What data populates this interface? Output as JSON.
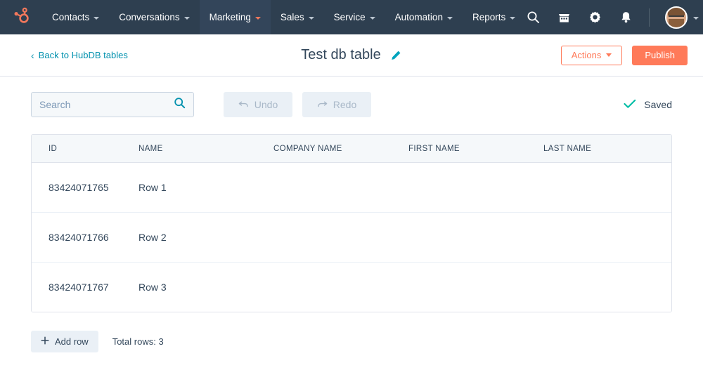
{
  "topnav": {
    "logo_icon": "hubspot-sprocket-logo",
    "items": [
      {
        "label": "Contacts",
        "active": false,
        "icon": "chevron-down-icon"
      },
      {
        "label": "Conversations",
        "active": false,
        "icon": "chevron-down-icon"
      },
      {
        "label": "Marketing",
        "active": true,
        "icon": "chevron-down-icon"
      },
      {
        "label": "Sales",
        "active": false,
        "icon": "chevron-down-icon"
      },
      {
        "label": "Service",
        "active": false,
        "icon": "chevron-down-icon"
      },
      {
        "label": "Automation",
        "active": false,
        "icon": "chevron-down-icon"
      },
      {
        "label": "Reports",
        "active": false,
        "icon": "chevron-down-icon"
      }
    ],
    "icons": [
      "search-icon",
      "marketplace-icon",
      "gear-icon",
      "notifications-bell-icon"
    ],
    "avatar_icon": "user-avatar",
    "avatar_caret_icon": "chevron-down-icon",
    "background_color": "#2e3f50",
    "active_background_color": "#33455a",
    "accent_color": "#f2785c"
  },
  "subheader": {
    "back_label": "Back to HubDB tables",
    "back_icon": "chevron-left-icon",
    "back_color": "#0091ae",
    "title": "Test db table",
    "edit_icon": "pencil-icon",
    "edit_icon_color": "#00a4bd",
    "actions_label": "Actions",
    "actions_caret_icon": "caret-down-icon",
    "publish_label": "Publish",
    "accent_color": "#ff7a59"
  },
  "toolbar": {
    "search_placeholder": "Search",
    "search_value": "",
    "search_icon": "search-icon",
    "undo_label": "Undo",
    "undo_icon": "undo-arrow-icon",
    "redo_label": "Redo",
    "redo_icon": "redo-arrow-icon",
    "saved_label": "Saved",
    "saved_icon": "check-icon",
    "saved_icon_color": "#00bda5"
  },
  "table": {
    "columns": [
      "ID",
      "NAME",
      "COMPANY NAME",
      "FIRST NAME",
      "LAST NAME"
    ],
    "rows": [
      {
        "id": "83424071765",
        "name": "Row 1",
        "company_name": "",
        "first_name": "",
        "last_name": ""
      },
      {
        "id": "83424071766",
        "name": "Row 2",
        "company_name": "",
        "first_name": "",
        "last_name": ""
      },
      {
        "id": "83424071767",
        "name": "Row 3",
        "company_name": "",
        "first_name": "",
        "last_name": ""
      }
    ]
  },
  "footer": {
    "add_row_label": "Add row",
    "add_row_icon": "plus-icon",
    "total_rows_label": "Total rows: 3"
  }
}
